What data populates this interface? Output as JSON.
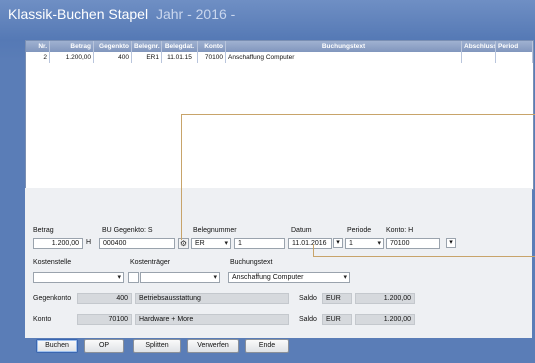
{
  "window": {
    "title": "Klassik-Buchen Stapel",
    "subtitle": "Jahr - 2016 -"
  },
  "grid": {
    "headers": [
      "Nr.",
      "Betrag",
      "Gegenkto",
      "Belegnr.",
      "Belegdat.",
      "Konto",
      "Buchungstext",
      "Abschluss",
      "Period"
    ],
    "rows": [
      [
        "2",
        "1.200,00",
        "400",
        "ER1",
        "11.01.15",
        "70100",
        "Anschaffung Computer",
        "",
        ""
      ]
    ]
  },
  "form": {
    "betrag": {
      "label": "Betrag",
      "value": "1.200,00",
      "suffix": "H"
    },
    "bu_gegenkto": {
      "label": "BU Gegenkto: S",
      "value": "000400"
    },
    "belegnummer": {
      "label": "Belegnummer",
      "type_value": "ER",
      "value": "1"
    },
    "datum": {
      "label": "Datum",
      "value": "11.01.2016"
    },
    "periode": {
      "label": "Periode",
      "value": "1"
    },
    "konto": {
      "label": "Konto: H",
      "value": "70100"
    },
    "kostenstelle": {
      "label": "Kostenstelle"
    },
    "kostentraeger": {
      "label": "Kostenträger"
    },
    "buchungstext": {
      "label": "Buchungstext",
      "value": "Anschaffung Computer"
    },
    "gegenkonto": {
      "label": "Gegenkonto",
      "number": "400",
      "name": "Betriebsausstattung",
      "saldo_label": "Saldo",
      "currency": "EUR",
      "saldo": "1.200,00"
    },
    "konto_row": {
      "label": "Konto",
      "number": "70100",
      "name": "Hardware + More",
      "saldo_label": "Saldo",
      "currency": "EUR",
      "saldo": "1.200,00"
    }
  },
  "buttons": {
    "buchen": "Buchen",
    "op": "OP",
    "splitten": "Splitten",
    "verwerfen": "Verwerfen",
    "ende": "Ende"
  },
  "colors": {
    "accent": "#c8a46a",
    "header": "#5579b5"
  }
}
